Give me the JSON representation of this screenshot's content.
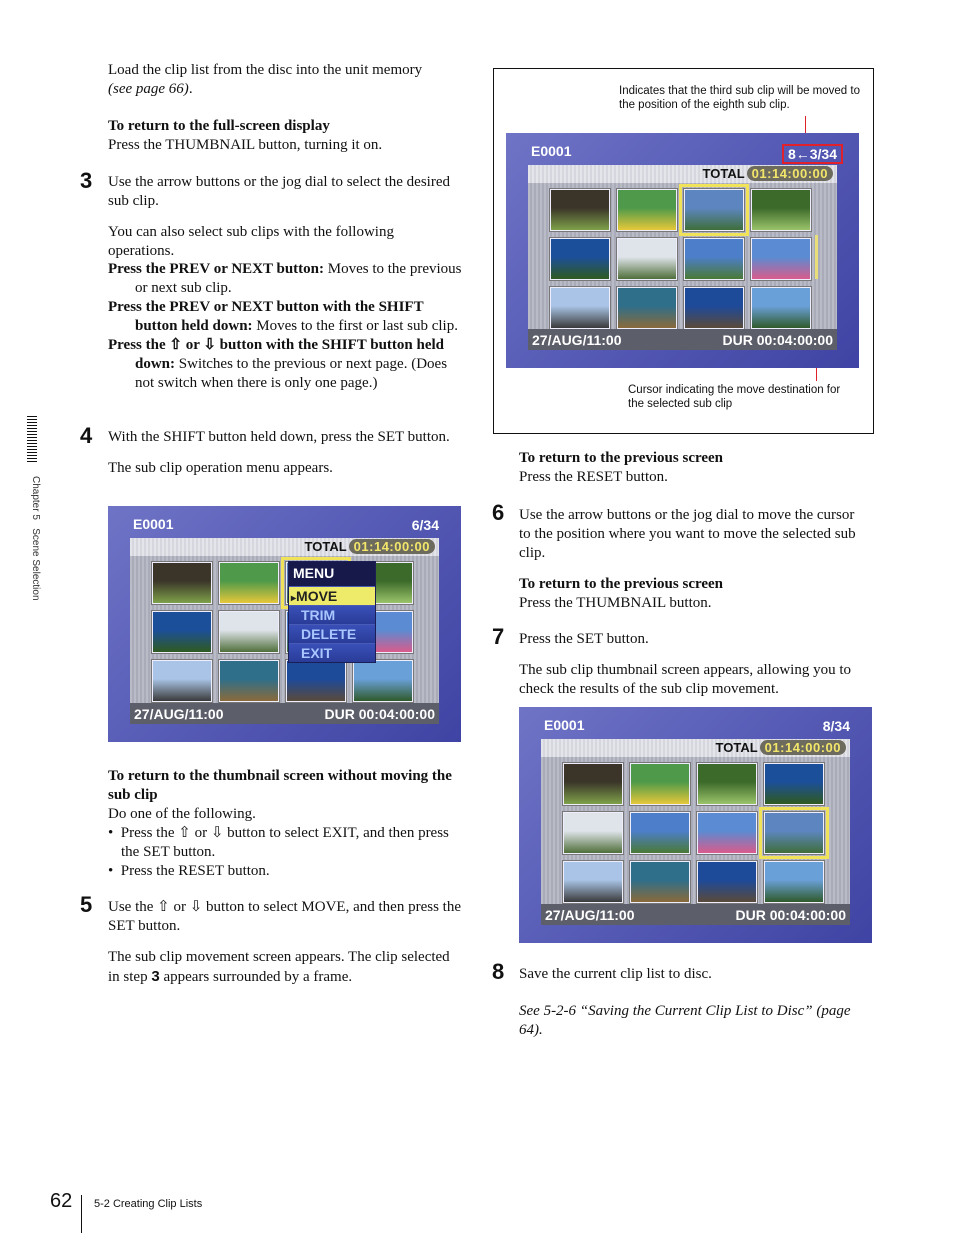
{
  "side_tab": {
    "label": "Chapter 5   Scene Selection"
  },
  "footer": {
    "page_number": "62",
    "section": "5-2 Creating Clip Lists"
  },
  "left": {
    "intro": {
      "text": "Load the clip list from the disc into the unit memory",
      "ref": "(see page 66)",
      "ref_suffix": "."
    },
    "fullscreen": {
      "heading": "To return to the full-screen display",
      "text": "Press the THUMBNAIL button, turning it on."
    },
    "step3": {
      "num": "3",
      "text": "Use the arrow buttons or the jog dial to select the desired sub clip.",
      "also": "You can also select sub clips with the following operations.",
      "ops": [
        {
          "term": "Press the PREV or NEXT button:",
          "desc": " Moves to the previous or next sub clip."
        },
        {
          "term": "Press the PREV or NEXT button with the SHIFT button held down:",
          "desc": " Moves to the first or last sub clip."
        },
        {
          "term": "Press the ⇧ or ⇩ button with the SHIFT button held down:",
          "desc": " Switches to the previous or next page. (Does not switch when there is only one page.)"
        }
      ]
    },
    "step4": {
      "num": "4",
      "text": "With the SHIFT button held down, press the SET button.",
      "result": "The sub clip operation menu appears."
    },
    "screen1": {
      "title": "E0001",
      "count": "6/34",
      "total_label": "TOTAL",
      "total_value": "01:14:00:00",
      "date": "27/AUG/11:00",
      "dur_label": "DUR",
      "dur_value": "00:04:00:00",
      "menu": {
        "title": "MENU",
        "items": [
          "MOVE",
          "TRIM",
          "DELETE",
          "EXIT"
        ],
        "selected": "MOVE",
        "pointer": "▸"
      }
    },
    "return_thumb": {
      "heading": "To return to the thumbnail screen without moving the sub clip",
      "text": "Do one of the following.",
      "bullets": [
        "Press the ⇧ or ⇩ button to select EXIT, and then press the SET button.",
        "Press the RESET button."
      ]
    },
    "step5": {
      "num": "5",
      "text": "Use the ⇧ or ⇩ button to select MOVE, and then press the SET button.",
      "result_a": "The sub clip movement screen appears. The clip selected in step ",
      "result_step": "3",
      "result_b": " appears surrounded by a frame."
    }
  },
  "right": {
    "figure": {
      "callout_top": "Indicates that the third sub clip will be moved to the position of the eighth sub clip.",
      "callout_bottom": "Cursor indicating the move destination for the selected sub clip",
      "screen": {
        "title": "E0001",
        "count": "8←3/34",
        "total_label": "TOTAL",
        "total_value": "01:14:00:00",
        "date": "27/AUG/11:00",
        "dur_label": "DUR",
        "dur_value": "00:04:00:00"
      },
      "highlight_color": "#e0202a"
    },
    "prev1": {
      "heading": "To return to the previous screen",
      "text": "Press the RESET button."
    },
    "step6": {
      "num": "6",
      "text": "Use the arrow buttons or the jog dial to move the cursor to the position where you want to move the selected sub clip."
    },
    "prev2": {
      "heading": "To return to the previous screen",
      "text": "Press the THUMBNAIL button."
    },
    "step7": {
      "num": "7",
      "text": "Press the SET button.",
      "result": "The sub clip thumbnail screen appears, allowing you to check the results of the sub clip movement."
    },
    "screen3": {
      "title": "E0001",
      "count": "8/34",
      "total_label": "TOTAL",
      "total_value": "01:14:00:00",
      "date": "27/AUG/11:00",
      "dur_label": "DUR",
      "dur_value": "00:04:00:00"
    },
    "step8": {
      "num": "8",
      "text": "Save the current clip list to disc.",
      "see": "See 5-2-6 “Saving the Current Clip List to Disc” (page 64)."
    }
  },
  "thumbnails": {
    "before": [
      "skunk-cabbage",
      "yellow-flowers",
      "palm-leaves",
      "white-flower-leaves",
      "green-tree",
      "tree-lined-road",
      "farm-road",
      "pink-flower-field",
      "sunset",
      "rocky-coast",
      "sea-cliff",
      "green-headland"
    ],
    "after": [
      "skunk-cabbage",
      "yellow-flowers",
      "white-flower-leaves",
      "green-tree",
      "tree-lined-road",
      "farm-road",
      "pink-flower-field",
      "palm-leaves",
      "sunset",
      "rocky-coast",
      "sea-cliff",
      "green-headland"
    ]
  },
  "thumb_colors": {
    "skunk-cabbage": [
      "#3b3529",
      "#7fa14a"
    ],
    "yellow-flowers": [
      "#4f9a4a",
      "#e6c83a"
    ],
    "palm-leaves": [
      "#5d86c0",
      "#3f6e3a"
    ],
    "white-flower-leaves": [
      "#3c6a2a",
      "#9ac36a"
    ],
    "green-tree": [
      "#1c4f9a",
      "#2f5a20"
    ],
    "tree-lined-road": [
      "#dfe4ea",
      "#4f6f3a"
    ],
    "farm-road": [
      "#4d7ec9",
      "#4a7a35"
    ],
    "pink-flower-field": [
      "#5b8bd2",
      "#d85b8b"
    ],
    "sunset": [
      "#a9c4e6",
      "#3a3a3a"
    ],
    "rocky-coast": [
      "#2f6f8a",
      "#8a6a3a"
    ],
    "sea-cliff": [
      "#1e4a9a",
      "#5a4a3a"
    ],
    "green-headland": [
      "#6aa0d8",
      "#2f5a2a"
    ]
  }
}
